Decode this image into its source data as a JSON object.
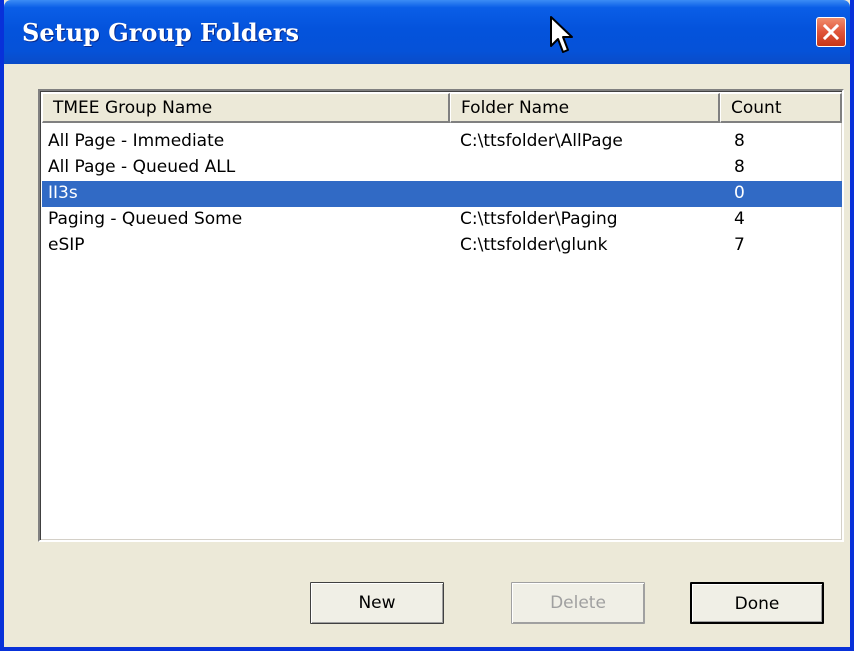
{
  "window": {
    "title": "Setup Group Folders"
  },
  "list": {
    "columns": [
      "TMEE Group Name",
      "Folder Name",
      "Count"
    ],
    "rows": [
      {
        "name": "All Page - Immediate",
        "folder": "C:\\ttsfolder\\AllPage",
        "count": "8",
        "selected": false
      },
      {
        "name": "All Page - Queued ALL",
        "folder": "",
        "count": "8",
        "selected": false
      },
      {
        "name": "II3s",
        "folder": "",
        "count": "0",
        "selected": true
      },
      {
        "name": "Paging - Queued Some",
        "folder": "C:\\ttsfolder\\Paging",
        "count": "4",
        "selected": false
      },
      {
        "name": "eSIP",
        "folder": "C:\\ttsfolder\\glunk",
        "count": "7",
        "selected": false
      }
    ]
  },
  "buttons": {
    "new": "New",
    "delete": "Delete",
    "done": "Done"
  },
  "colors": {
    "titlebar": "#0453dc",
    "selection": "#316ac5",
    "face": "#ece9d8"
  }
}
